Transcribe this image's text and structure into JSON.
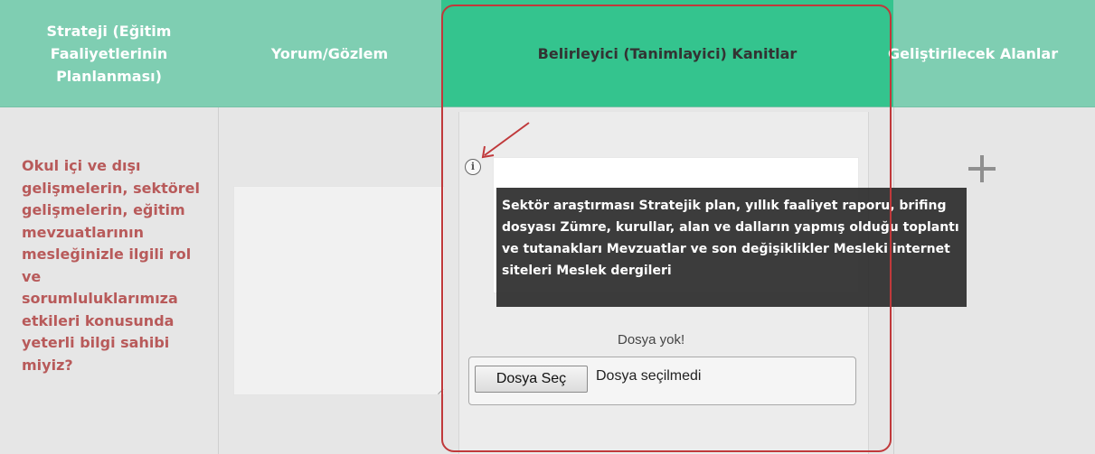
{
  "table": {
    "headers": [
      "Strateji (Eğitim\nFaaliyetlerinin\nPlanlanması)",
      "Yorum/Gözlem",
      "Belirleyici (Tanimlayici) Kanitlar",
      "Geliştirilecek Alanlar"
    ],
    "question_lines": [
      "Okul içi ve dışı",
      "gelişmelerin, sektörel",
      "gelişmelerin, eğitim",
      "mevzuatlarının",
      "mesleğinizle ilgili rol",
      "ve",
      "sorumluluklarımıza",
      "etkileri konusunda",
      "yeterli bilgi sahibi",
      "miyiz?"
    ]
  },
  "evidence": {
    "tooltip_lines": [
      "Sektör araştırması Stratejik plan, yıllık faaliyet raporu, brifing",
      "dosyası Zümre, kurullar, alan ve dalların yapmış olduğu toplantı",
      "ve tutanakları Mevzuatlar ve son değişiklikler Mesleki internet",
      "siteleri Meslek dergileri"
    ],
    "file_status": "Dosya yok!",
    "file_button": "Dosya Seç",
    "file_name": "Dosya seçilmedi"
  },
  "icons": {
    "info": "info-icon",
    "add": "plus-icon",
    "arrow": "red-arrow-annotation"
  },
  "colors": {
    "header_bg": "#7fceb2",
    "active_header_bg": "#34c48e",
    "question_text": "#b85a5a",
    "highlight_border": "#c0393b"
  }
}
